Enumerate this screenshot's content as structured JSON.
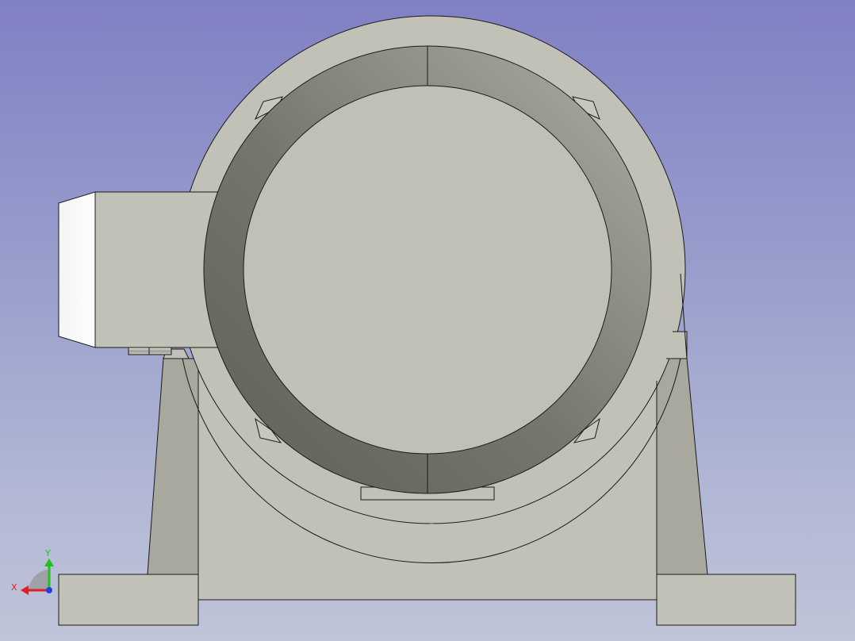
{
  "viewport": {
    "background_top": "#8080c4",
    "background_bottom": "#c0c4d8"
  },
  "model": {
    "body_color": "#c2c1b7",
    "side_face_color": "#a9a89e",
    "ring_dark": "#64655a",
    "ring_light": "#a4a49c",
    "housing_white": "#ffffff",
    "edge_color": "#1a1a1a"
  },
  "axis_triad": {
    "x_label": "X",
    "y_label": "Y",
    "x_color": "#e02020",
    "y_color": "#20c020",
    "z_color": "#2040e0",
    "x_icon": "x-axis-arrow-icon",
    "y_icon": "y-axis-arrow-icon",
    "z_icon": "z-axis-dot-icon"
  }
}
